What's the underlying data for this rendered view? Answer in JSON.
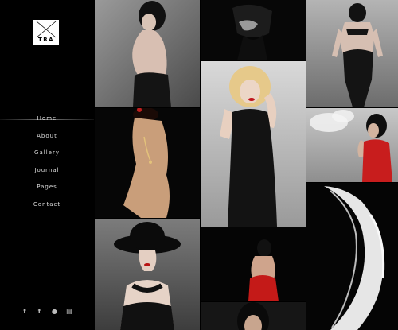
{
  "brand": {
    "logo_text": "TRA"
  },
  "nav": {
    "items": [
      {
        "label": "Home"
      },
      {
        "label": "About"
      },
      {
        "label": "Gallery"
      },
      {
        "label": "Journal"
      },
      {
        "label": "Pages"
      },
      {
        "label": "Contact"
      }
    ]
  },
  "social": [
    {
      "icon": "facebook-icon",
      "glyph": "f"
    },
    {
      "icon": "twitter-icon",
      "glyph": "t"
    },
    {
      "icon": "flickr-icon",
      "glyph": "●"
    },
    {
      "icon": "print-icon",
      "glyph": "▤"
    }
  ],
  "gallery": {
    "tiles": [
      {
        "name": "photo-woman-back-black-gown"
      },
      {
        "name": "photo-woman-black-hat-pose"
      },
      {
        "name": "photo-woman-necklace-crossed-arms"
      },
      {
        "name": "photo-woman-wide-brim-hat-necklace"
      },
      {
        "name": "photo-blonde-woman-black-dress"
      },
      {
        "name": "photo-woman-red-dress-back"
      },
      {
        "name": "photo-woman-dark-hair-portrait"
      },
      {
        "name": "photo-woman-black-dress-back-view"
      },
      {
        "name": "photo-woman-smoking-red-dress"
      },
      {
        "name": "photo-white-fabric-figure"
      }
    ]
  }
}
